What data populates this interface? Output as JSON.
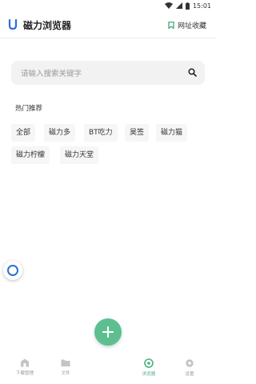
{
  "status": {
    "time": "15:01"
  },
  "header": {
    "app_title": "磁力浏览器",
    "bookmarks_label": "网址收藏"
  },
  "search": {
    "placeholder": "请输入搜索关键字",
    "value": ""
  },
  "hot": {
    "title": "热门推荐",
    "tags": [
      "全部",
      "磁力多",
      "BT吃力",
      "昊签",
      "磁力猫",
      "磁力柠檬",
      "磁力天堂"
    ]
  },
  "bottom_nav": {
    "items": [
      {
        "label": "下载管理",
        "icon": "download-manager-icon"
      },
      {
        "label": "文件",
        "icon": "folder-icon"
      },
      {
        "label": "浏览器",
        "icon": "browser-icon"
      },
      {
        "label": "设置",
        "icon": "gear-icon"
      }
    ],
    "add_button_icon": "plus-icon"
  },
  "colors": {
    "accent_green": "#5cbf8f",
    "logo_blue": "#2a6fd6"
  }
}
